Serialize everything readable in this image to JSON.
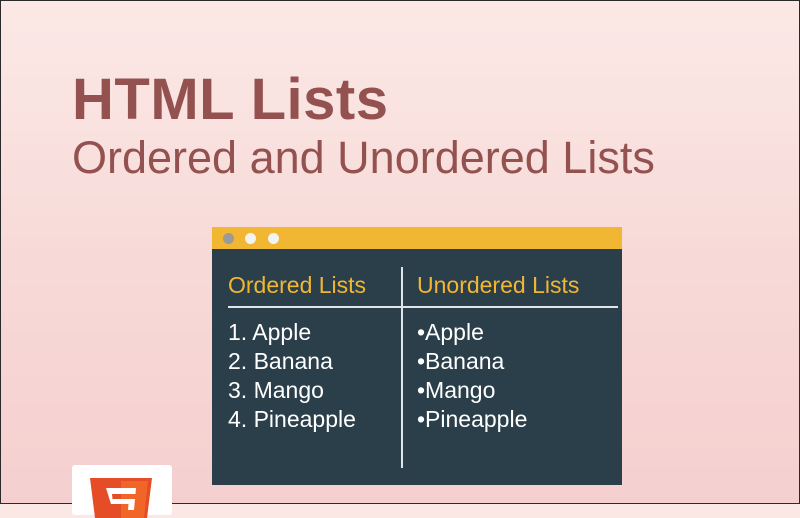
{
  "title": "HTML Lists",
  "subtitle": "Ordered and Unordered Lists",
  "window": {
    "colors": {
      "bar": "#f1b733",
      "body": "#2b3f4a",
      "header_text": "#f1b733",
      "item_text": "#ffffff"
    },
    "ordered": {
      "header": "Ordered Lists",
      "items": [
        "1. Apple",
        "2. Banana",
        "3. Mango",
        "4. Pineapple"
      ]
    },
    "unordered": {
      "header": "Unordered Lists",
      "items": [
        "•Apple",
        "•Banana",
        "•Mango",
        "•Pineapple"
      ]
    }
  },
  "logo": {
    "icon": "html5-shield-icon",
    "color": "#e44d26"
  },
  "colors": {
    "title": "#935250",
    "background": "#f7d9d7"
  }
}
